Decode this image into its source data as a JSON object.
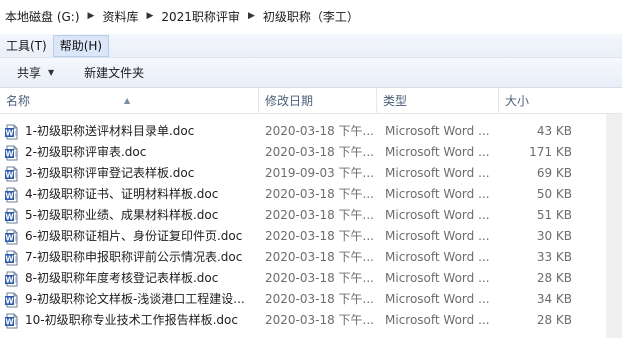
{
  "breadcrumb": [
    "本地磁盘 (G:)",
    "资料库",
    "2021职称评审",
    "初级职称（李工）"
  ],
  "menu": {
    "items": [
      "工具(T)",
      "帮助(H)"
    ],
    "active_index": 1
  },
  "toolbar": {
    "share_label": "共享",
    "new_folder_label": "新建文件夹"
  },
  "columns": {
    "name": "名称",
    "modified": "修改日期",
    "type": "类型",
    "size": "大小"
  },
  "files": [
    {
      "name": "1-初级职称送评材料目录单.doc",
      "modified": "2020-03-18 下午...",
      "type": "Microsoft Word ...",
      "size": "43 KB"
    },
    {
      "name": "2-初级职称评审表.doc",
      "modified": "2020-03-18 下午...",
      "type": "Microsoft Word ...",
      "size": "171 KB"
    },
    {
      "name": "3-初级职称评审登记表样板.doc",
      "modified": "2019-09-03 下午...",
      "type": "Microsoft Word ...",
      "size": "69 KB"
    },
    {
      "name": "4-初级职称证书、证明材料样板.doc",
      "modified": "2020-03-18 下午...",
      "type": "Microsoft Word ...",
      "size": "50 KB"
    },
    {
      "name": "5-初级职称业绩、成果材料样板.doc",
      "modified": "2020-03-18 下午...",
      "type": "Microsoft Word ...",
      "size": "51 KB"
    },
    {
      "name": "6-初级职称证相片、身份证复印件页.doc",
      "modified": "2020-03-18 下午...",
      "type": "Microsoft Word ...",
      "size": "30 KB"
    },
    {
      "name": "7-初级职称申报职称评前公示情况表.doc",
      "modified": "2020-03-18 下午...",
      "type": "Microsoft Word ...",
      "size": "33 KB"
    },
    {
      "name": "8-初级职称年度考核登记表样板.doc",
      "modified": "2020-03-18 下午...",
      "type": "Microsoft Word ...",
      "size": "28 KB"
    },
    {
      "name": "9-初级职称论文样板-浅谈港口工程建设...",
      "modified": "2020-03-18 下午...",
      "type": "Microsoft Word ...",
      "size": "34 KB"
    },
    {
      "name": "10-初级职称专业技术工作报告样板.doc",
      "modified": "2020-03-18 下午...",
      "type": "Microsoft Word ...",
      "size": "28 KB"
    }
  ]
}
